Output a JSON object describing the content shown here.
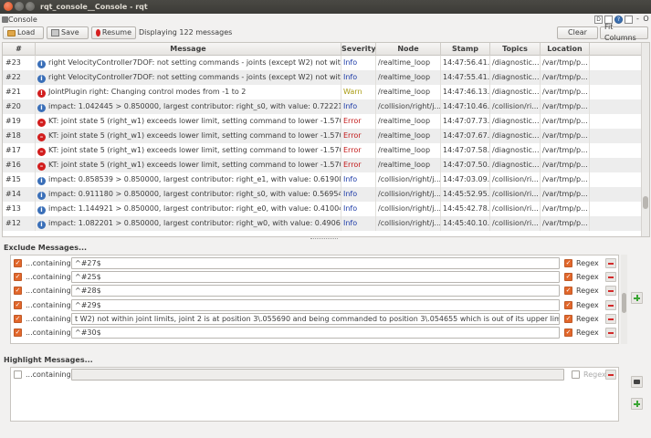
{
  "window": {
    "title": "rqt_console__Console - rqt"
  },
  "plugin": {
    "title": "Console",
    "ctrl_d": "D",
    "ctrl_help": "?",
    "ctrl_min": "-",
    "ctrl_close": "O"
  },
  "toolbar": {
    "load_label": "Load",
    "save_label": "Save",
    "resume_label": "Resume",
    "status": "Displaying 122 messages",
    "clear_label": "Clear",
    "fit_label": "Fit Columns"
  },
  "table": {
    "headers": [
      "#",
      "Message",
      "Severity",
      "Node",
      "Stamp",
      "Topics",
      "Location"
    ],
    "rows": [
      {
        "num": "#23",
        "sev_class": "info",
        "msg": "right VelocityController7DOF: not setting commands - joints (except W2) not within joi...",
        "severity": "Info",
        "node": "/realtime_loop",
        "stamp": "14:47:56.41...",
        "topics": "/diagnostic...",
        "loc": "/var/tmp/p..."
      },
      {
        "num": "#22",
        "sev_class": "info",
        "msg": "right VelocityController7DOF: not setting commands - joints (except W2) not within joi...",
        "severity": "Info",
        "node": "/realtime_loop",
        "stamp": "14:47:55.41...",
        "topics": "/diagnostic...",
        "loc": "/var/tmp/p..."
      },
      {
        "num": "#21",
        "sev_class": "warn",
        "msg": "JointPlugin right: Changing control modes from -1 to 2",
        "severity": "Warn",
        "node": "/realtime_loop",
        "stamp": "14:47:46.13...",
        "topics": "/diagnostic...",
        "loc": "/var/tmp/p..."
      },
      {
        "num": "#20",
        "sev_class": "info",
        "msg": "impact: 1.042445 > 0.850000, largest contributor: right_s0, with value: 0.722210",
        "severity": "Info",
        "node": "/collision/right/j...",
        "stamp": "14:47:10.46...",
        "topics": "/collision/ri...",
        "loc": "/var/tmp/p..."
      },
      {
        "num": "#19",
        "sev_class": "error",
        "msg": "KT: joint state 5 (right_w1) exceeds lower limit, setting command to lower -1.570796",
        "severity": "Error",
        "node": "/realtime_loop",
        "stamp": "14:47:07.73...",
        "topics": "/diagnostic...",
        "loc": "/var/tmp/p..."
      },
      {
        "num": "#18",
        "sev_class": "error",
        "msg": "KT: joint state 5 (right_w1) exceeds lower limit, setting command to lower -1.570796",
        "severity": "Error",
        "node": "/realtime_loop",
        "stamp": "14:47:07.67...",
        "topics": "/diagnostic...",
        "loc": "/var/tmp/p..."
      },
      {
        "num": "#17",
        "sev_class": "error",
        "msg": "KT: joint state 5 (right_w1) exceeds lower limit, setting command to lower -1.570796",
        "severity": "Error",
        "node": "/realtime_loop",
        "stamp": "14:47:07.58...",
        "topics": "/diagnostic...",
        "loc": "/var/tmp/p..."
      },
      {
        "num": "#16",
        "sev_class": "error",
        "msg": "KT: joint state 5 (right_w1) exceeds lower limit, setting command to lower -1.570796",
        "severity": "Error",
        "node": "/realtime_loop",
        "stamp": "14:47:07.50...",
        "topics": "/diagnostic...",
        "loc": "/var/tmp/p..."
      },
      {
        "num": "#15",
        "sev_class": "info",
        "msg": "impact: 0.858539 > 0.850000, largest contributor: right_e1, with value: 0.619085",
        "severity": "Info",
        "node": "/collision/right/j...",
        "stamp": "14:47:03.09...",
        "topics": "/collision/ri...",
        "loc": "/var/tmp/p..."
      },
      {
        "num": "#14",
        "sev_class": "info",
        "msg": "impact: 0.911180 > 0.850000, largest contributor: right_s0, with value: 0.569542",
        "severity": "Info",
        "node": "/collision/right/j...",
        "stamp": "14:45:52.95...",
        "topics": "/collision/ri...",
        "loc": "/var/tmp/p..."
      },
      {
        "num": "#13",
        "sev_class": "info",
        "msg": "impact: 1.144921 > 0.850000, largest contributor: right_e0, with value: 0.410046",
        "severity": "Info",
        "node": "/collision/right/j...",
        "stamp": "14:45:42.78...",
        "topics": "/collision/ri...",
        "loc": "/var/tmp/p..."
      },
      {
        "num": "#12",
        "sev_class": "info",
        "msg": "impact: 1.082201 > 0.850000, largest contributor: right_w0, with value: 0.490625",
        "severity": "Info",
        "node": "/collision/right/j...",
        "stamp": "14:45:40.10...",
        "topics": "/collision/ri...",
        "loc": "/var/tmp/p..."
      }
    ]
  },
  "exclude": {
    "title": "Exclude Messages...",
    "containing_label": "...containing:",
    "regex_label": "Regex",
    "rows": [
      {
        "value": "^#27$"
      },
      {
        "value": "^#25$"
      },
      {
        "value": "^#28$"
      },
      {
        "value": "^#29$"
      },
      {
        "value": "t W2) not within joint limits, joint 2 is at position 3\\.055690 and being commanded to position 3\\.054655 which is out of its upper limit of 3\\.054180$"
      },
      {
        "value": "^#30$"
      }
    ]
  },
  "highlight": {
    "title": "Highlight Messages...",
    "containing_label": "...containing:",
    "regex_label": "Regex",
    "value": ""
  }
}
